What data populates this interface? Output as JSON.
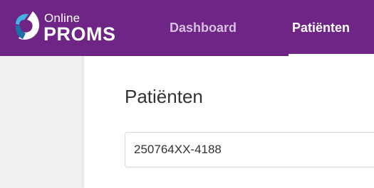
{
  "brand": {
    "line1": "Online",
    "line2": "PROMS",
    "primary_color": "#6e2585",
    "icon": "proms-logo-icon"
  },
  "nav": {
    "items": [
      {
        "label": "Dashboard",
        "active": false
      },
      {
        "label": "Patiënten",
        "active": true
      }
    ]
  },
  "main": {
    "title": "Patiënten",
    "search": {
      "value": "250764XX-4188"
    }
  }
}
